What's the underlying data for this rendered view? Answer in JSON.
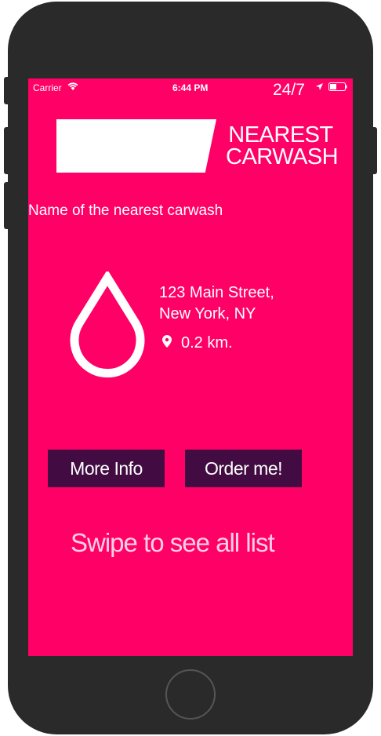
{
  "status_bar": {
    "carrier": "Carrier",
    "time": "6:44 PM",
    "badge": "24/7"
  },
  "header": {
    "title_line1": "NEAREST",
    "title_line2": "CARWASH"
  },
  "carwash": {
    "name": "Name of the nearest carwash",
    "address_line1": "123 Main Street,",
    "address_line2": "New York, NY",
    "distance": "0.2 km."
  },
  "buttons": {
    "more_info": "More Info",
    "order": "Order me!"
  },
  "hint": "Swipe to see all list",
  "colors": {
    "background": "#ff0066",
    "button": "#420c42"
  }
}
